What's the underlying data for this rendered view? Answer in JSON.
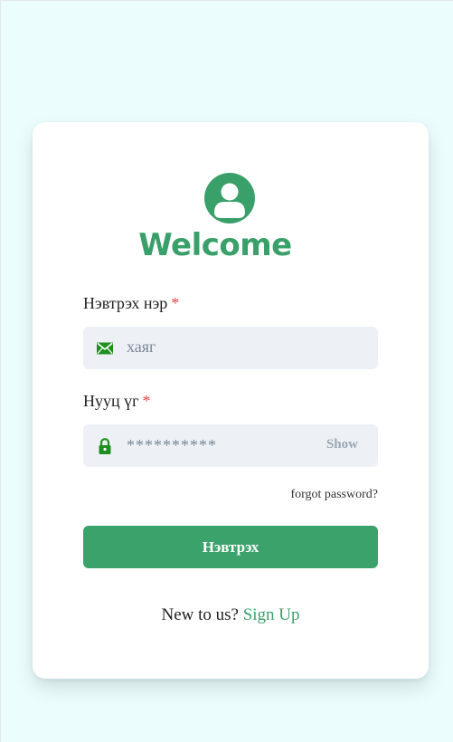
{
  "header": {
    "title": "Welcome"
  },
  "form": {
    "username": {
      "label": "Нэвтрэх нэр",
      "required_marker": "*",
      "placeholder": "хаяг",
      "icon": "mail-icon"
    },
    "password": {
      "label": "Нууц үг",
      "required_marker": "*",
      "placeholder": "**********",
      "icon": "lock-icon",
      "show_label": "Show"
    },
    "forgot_label": "forgot password?",
    "submit_label": "Нэвтрэх"
  },
  "signup": {
    "prompt": "New to us?",
    "link_label": "Sign Up"
  },
  "colors": {
    "brand": "#3aa06a",
    "background": "#ebfdfd",
    "field_bg": "#edf1f6",
    "required": "#e04848"
  }
}
